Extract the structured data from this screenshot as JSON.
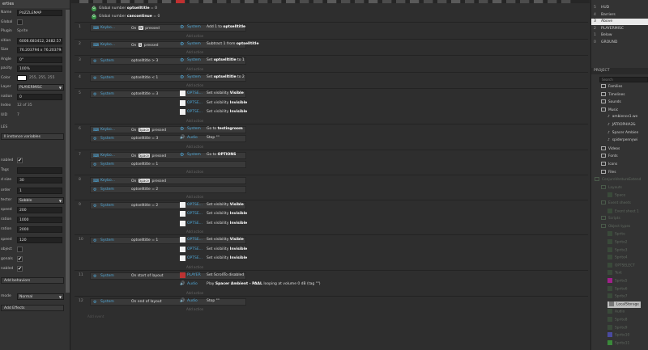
{
  "properties": {
    "header": "erties",
    "rows": [
      {
        "label": "Name",
        "value": "PUZZLEMAP",
        "kind": "field"
      },
      {
        "label": "Global",
        "value": "",
        "kind": "check"
      },
      {
        "label": "Plugin",
        "value": "Sprite",
        "kind": "text"
      },
      {
        "label": "sition",
        "value": "6006.683412, 2482.57595",
        "kind": "field"
      },
      {
        "label": "Size",
        "value": "76.203794 x 76.203794",
        "kind": "field"
      },
      {
        "label": "Angle",
        "value": "0°",
        "kind": "field"
      },
      {
        "label": "pacity",
        "value": "100%",
        "kind": "field"
      },
      {
        "label": "Color",
        "value": "255, 255, 255",
        "kind": "color"
      },
      {
        "label": "Layer",
        "value": "PLAYERMISC",
        "kind": "dropdown"
      },
      {
        "label": "nation",
        "value": "0",
        "kind": "field"
      },
      {
        "label": "Index",
        "value": "12 of 35",
        "kind": "text"
      },
      {
        "label": "UID",
        "value": "7",
        "kind": "text"
      }
    ],
    "section_les": "LES",
    "instance_vars_button": "ll instance variables",
    "rows2": [
      {
        "label": "nabled",
        "value": "✔",
        "kind": "check"
      },
      {
        "label": "Tags",
        "value": "",
        "kind": "field"
      },
      {
        "label": "d size",
        "value": "30",
        "kind": "field"
      },
      {
        "label": "order",
        "value": "1",
        "kind": "field"
      },
      {
        "label": "tector",
        "value": "Sobble",
        "kind": "dropdown"
      },
      {
        "label": "speed",
        "value": "200",
        "kind": "field"
      },
      {
        "label": "ration",
        "value": "1000",
        "kind": "field"
      },
      {
        "label": "ration",
        "value": "2000",
        "kind": "field"
      },
      {
        "label": "speed",
        "value": "120",
        "kind": "field"
      },
      {
        "label": "object",
        "value": "",
        "kind": "check"
      },
      {
        "label": "gonals",
        "value": "✔",
        "kind": "check"
      },
      {
        "label": "nabled",
        "value": "✔",
        "kind": "check"
      }
    ],
    "add_behaviors_button": "Add behaviors",
    "mode_label": "mode",
    "mode_value": "Normal",
    "add_effects_button": "Add Effects"
  },
  "global_vars": [
    {
      "text_pre": "Global number ",
      "name": "optselltitle",
      "text_post": " = 0"
    },
    {
      "text_pre": "Global number ",
      "name": "cancontinue",
      "text_post": " = 0"
    }
  ],
  "events": [
    {
      "num": "1",
      "conds": [
        {
          "obj": "Keybo...",
          "html_pre": "On ",
          "key": "W",
          "html_post": " pressed"
        }
      ],
      "actions": [
        {
          "obj": "System",
          "pre": "Add 1 to ",
          "bold": "optselltitle",
          "post": "",
          "icon": "system"
        }
      ]
    },
    {
      "num": "2",
      "conds": [
        {
          "obj": "Keybo...",
          "html_pre": "On ",
          "key": "S",
          "html_post": " pressed"
        }
      ],
      "actions": [
        {
          "obj": "System",
          "pre": "Subtract 1 from ",
          "bold": "optselltitle",
          "post": "",
          "icon": "system"
        }
      ]
    },
    {
      "num": "3",
      "conds": [
        {
          "obj": "System",
          "html_pre": "optselltitle > 3",
          "key": "",
          "html_post": ""
        }
      ],
      "actions": [
        {
          "obj": "System",
          "pre": "Set ",
          "bold": "optselltitle",
          "post": " to 1",
          "icon": "system"
        }
      ]
    },
    {
      "num": "4",
      "conds": [
        {
          "obj": "System",
          "html_pre": "optselltitle < 1",
          "key": "",
          "html_post": ""
        }
      ],
      "actions": [
        {
          "obj": "System",
          "pre": "Set ",
          "bold": "optselltitle",
          "post": " to 2",
          "icon": "system"
        }
      ]
    },
    {
      "num": "5",
      "conds": [
        {
          "obj": "System",
          "html_pre": "optselltitle = 3",
          "key": "",
          "html_post": ""
        }
      ],
      "actions": [
        {
          "obj": "OPTSE...",
          "pre": "Set visibility ",
          "bold": "Visible",
          "post": "",
          "icon": "white"
        },
        {
          "obj": "OPTSE...",
          "pre": "Set visibility ",
          "bold": "Invisible",
          "post": "",
          "icon": "white"
        },
        {
          "obj": "OPTSE...",
          "pre": "Set visibility ",
          "bold": "Invisible",
          "post": "",
          "icon": "white"
        }
      ]
    },
    {
      "num": "6",
      "conds": [
        {
          "obj": "Keybo...",
          "html_pre": "On ",
          "key": "Space",
          "html_post": " pressed"
        },
        {
          "obj": "System",
          "html_pre": "optselltitle = 3",
          "key": "",
          "html_post": ""
        }
      ],
      "actions": [
        {
          "obj": "System",
          "pre": "Go to ",
          "bold": "testingroom",
          "post": "",
          "icon": "system"
        },
        {
          "obj": "Audio",
          "pre": "Stop \"\"",
          "bold": "",
          "post": "",
          "icon": "audio"
        }
      ]
    },
    {
      "num": "7",
      "conds": [
        {
          "obj": "Keybo...",
          "html_pre": "On ",
          "key": "Space",
          "html_post": " pressed"
        },
        {
          "obj": "System",
          "html_pre": "optselltitle = 1",
          "key": "",
          "html_post": ""
        }
      ],
      "actions": [
        {
          "obj": "System",
          "pre": "Go to ",
          "bold": "OPTIONS",
          "post": "",
          "icon": "system"
        }
      ]
    },
    {
      "num": "8",
      "conds": [
        {
          "obj": "Keybo...",
          "html_pre": "On ",
          "key": "Space",
          "html_post": " pressed"
        },
        {
          "obj": "System",
          "html_pre": "optselltitle = 2",
          "key": "",
          "html_post": ""
        }
      ],
      "actions": []
    },
    {
      "num": "9",
      "conds": [
        {
          "obj": "System",
          "html_pre": "optselltitle = 2",
          "key": "",
          "html_post": ""
        }
      ],
      "actions": [
        {
          "obj": "OPTSE...",
          "pre": "Set visibility ",
          "bold": "Visible",
          "post": "",
          "icon": "white"
        },
        {
          "obj": "OPTSE...",
          "pre": "Set visibility ",
          "bold": "Invisible",
          "post": "",
          "icon": "white"
        },
        {
          "obj": "OPTSE...",
          "pre": "Set visibility ",
          "bold": "Invisible",
          "post": "",
          "icon": "white"
        }
      ]
    },
    {
      "num": "10",
      "conds": [
        {
          "obj": "System",
          "html_pre": "optselltitle = 1",
          "key": "",
          "html_post": ""
        }
      ],
      "actions": [
        {
          "obj": "OPTSE...",
          "pre": "Set visibility ",
          "bold": "Visible",
          "post": "",
          "icon": "white"
        },
        {
          "obj": "OPTSE...",
          "pre": "Set visibility ",
          "bold": "Invisible",
          "post": "",
          "icon": "white"
        },
        {
          "obj": "OPTSE...",
          "pre": "Set visibility ",
          "bold": "Invisible",
          "post": "",
          "icon": "white"
        }
      ]
    },
    {
      "num": "11",
      "conds": [
        {
          "obj": "System",
          "html_pre": "On start of layout",
          "key": "",
          "html_post": ""
        }
      ],
      "actions": [
        {
          "obj": "PLAYER",
          "pre": "Set ",
          "bold": "",
          "post": " ScrollTo disabled",
          "icon": "player"
        },
        {
          "obj": "Audio",
          "pre": "Play ",
          "bold": "Spacer Ambient - PAAL",
          "post": " looping at volume 0 dB (tag \"\")",
          "icon": "audio"
        }
      ]
    },
    {
      "num": "12",
      "conds": [
        {
          "obj": "System",
          "html_pre": "On end of layout",
          "key": "",
          "html_post": ""
        }
      ],
      "actions": [
        {
          "obj": "Audio",
          "pre": "Stop \"\"",
          "bold": "",
          "post": "",
          "icon": "audio"
        }
      ]
    }
  ],
  "add_action_label": "Add action",
  "add_event_label": "Add event",
  "layers": [
    {
      "num": "5",
      "name": "HUD"
    },
    {
      "num": "4",
      "name": "Barriers"
    },
    {
      "num": "3",
      "name": "Above",
      "selected": true
    },
    {
      "num": "2",
      "name": "PLAYERMISC"
    },
    {
      "num": "1",
      "name": "Below"
    },
    {
      "num": "0",
      "name": "GROUND"
    }
  ],
  "project": {
    "header": "PROJECT",
    "search_placeholder": "Search",
    "tree": [
      {
        "label": "Families",
        "type": "folder",
        "indent": 0,
        "dim": false
      },
      {
        "label": "Timelines",
        "type": "folder",
        "indent": 0,
        "dim": false
      },
      {
        "label": "Sounds",
        "type": "folder",
        "indent": 0,
        "dim": false
      },
      {
        "label": "Music",
        "type": "folder",
        "indent": 0,
        "dim": false
      },
      {
        "label": "ambience1.we",
        "type": "note",
        "indent": 1,
        "dim": false
      },
      {
        "label": "JATROPHIA2&",
        "type": "note",
        "indent": 1,
        "dim": false
      },
      {
        "label": "Spacer Ambien",
        "type": "note",
        "indent": 1,
        "dim": false
      },
      {
        "label": "spiderpennywi",
        "type": "note",
        "indent": 1,
        "dim": false
      },
      {
        "label": "Videos",
        "type": "folder",
        "indent": 0,
        "dim": false
      },
      {
        "label": "Fonts",
        "type": "folder",
        "indent": 0,
        "dim": false
      },
      {
        "label": "Icons",
        "type": "folder",
        "indent": 0,
        "dim": false
      },
      {
        "label": "Files",
        "type": "folder",
        "indent": 0,
        "dim": false
      },
      {
        "label": "ConjureVentureExtend",
        "type": "folder",
        "indent": -1,
        "dim": true
      },
      {
        "label": "Layouts",
        "type": "folder",
        "indent": 0,
        "dim": true
      },
      {
        "label": "Space",
        "type": "item",
        "indent": 1,
        "dim": true
      },
      {
        "label": "Event sheets",
        "type": "folder",
        "indent": 0,
        "dim": true
      },
      {
        "label": "Event sheet 1",
        "type": "item",
        "indent": 1,
        "dim": true
      },
      {
        "label": "Scripts",
        "type": "folder",
        "indent": 0,
        "dim": true
      },
      {
        "label": "Object types",
        "type": "folder",
        "indent": 0,
        "dim": true
      },
      {
        "label": "Sprite",
        "type": "item",
        "indent": 1,
        "dim": true
      },
      {
        "label": "Sprite2",
        "type": "item",
        "indent": 1,
        "dim": true
      },
      {
        "label": "Sprite3",
        "type": "item",
        "indent": 1,
        "dim": true
      },
      {
        "label": "Sprite4",
        "type": "item",
        "indent": 1,
        "dim": true
      },
      {
        "label": "OPTSELECT",
        "type": "item",
        "indent": 1,
        "dim": true
      },
      {
        "label": "Text",
        "type": "item",
        "indent": 1,
        "dim": true
      },
      {
        "label": "Sprite5",
        "type": "swatch",
        "indent": 1,
        "dim": true,
        "color": "#a0208a"
      },
      {
        "label": "Sprite6",
        "type": "item",
        "indent": 1,
        "dim": true
      },
      {
        "label": "Sprite7",
        "type": "item",
        "indent": 1,
        "dim": true
      },
      {
        "label": "LocalStorage",
        "type": "sel",
        "indent": 1,
        "dim": false
      },
      {
        "label": "Audio",
        "type": "item",
        "indent": 1,
        "dim": true
      },
      {
        "label": "Sprite8",
        "type": "item",
        "indent": 1,
        "dim": true
      },
      {
        "label": "Sprite9",
        "type": "item",
        "indent": 1,
        "dim": true
      },
      {
        "label": "Sprite10",
        "type": "swatch",
        "indent": 1,
        "dim": true,
        "color": "#4a4aa0"
      },
      {
        "label": "Sprite11",
        "type": "swatch",
        "indent": 1,
        "dim": true,
        "color": "#3a8a3a"
      }
    ]
  },
  "colors": {
    "accent": "#4fa8d8",
    "green": "#3c9a4a",
    "selected_layer": "#e9e9e9",
    "bg": "#2e2e2e"
  }
}
